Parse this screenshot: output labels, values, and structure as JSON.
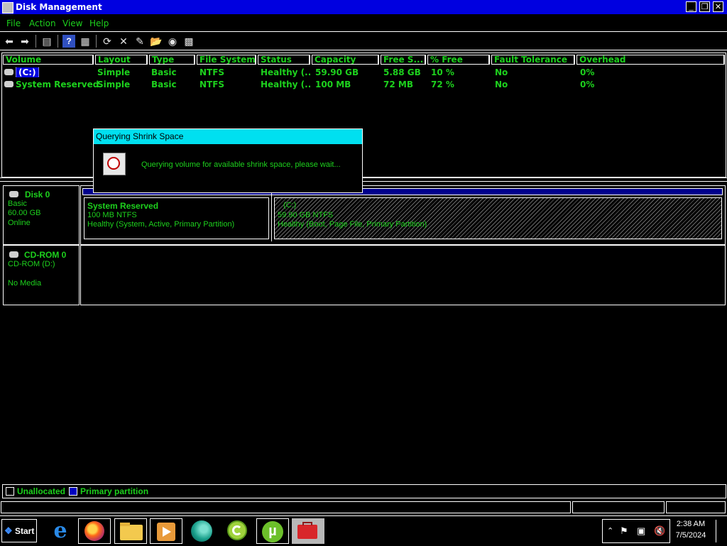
{
  "window": {
    "title": "Disk Management"
  },
  "menu": [
    "File",
    "Action",
    "View",
    "Help"
  ],
  "toolbar": {
    "buttons": [
      "back-icon",
      "forward-icon",
      "list-view-icon",
      "help-icon",
      "properties-icon",
      "refresh-icon",
      "delete-icon",
      "rename-icon",
      "open-icon",
      "explore-icon",
      "settings-icon"
    ]
  },
  "volume_list": {
    "columns": [
      "Volume",
      "Layout",
      "Type",
      "File System",
      "Status",
      "Capacity",
      "Free S...",
      "% Free",
      "Fault Tolerance",
      "Overhead"
    ],
    "rows": [
      {
        "volume": "(C:)",
        "layout": "Simple",
        "type": "Basic",
        "fs": "NTFS",
        "status": "Healthy (...",
        "capacity": "59.90 GB",
        "free": "5.88 GB",
        "pct_free": "10 %",
        "fault": "No",
        "overhead": "0%",
        "selected": true
      },
      {
        "volume": "System Reserved",
        "layout": "Simple",
        "type": "Basic",
        "fs": "NTFS",
        "status": "Healthy (...",
        "capacity": "100 MB",
        "free": "72 MB",
        "pct_free": "72 %",
        "fault": "No",
        "overhead": "0%",
        "selected": false
      }
    ]
  },
  "disks": [
    {
      "name": "Disk 0",
      "type": "Basic",
      "size": "60.00 GB",
      "state": "Online",
      "partitions": [
        {
          "name": "System Reserved",
          "size": "100 MB NTFS",
          "status": "Healthy (System, Active, Primary Partition)"
        },
        {
          "name": "(C:)",
          "size": "59.90 GB NTFS",
          "status": "Healthy (Boot, Page File, Primary Partition)"
        }
      ]
    },
    {
      "name": "CD-ROM 0",
      "type": "CD-ROM (D:)",
      "state": "No Media"
    }
  ],
  "dialog": {
    "title": "Querying Shrink Space",
    "message": "Querying volume for available shrink space, please wait..."
  },
  "legend": [
    {
      "label": "Unallocated",
      "color": "#000000"
    },
    {
      "label": "Primary partition",
      "color": "#0000c0"
    }
  ],
  "taskbar": {
    "start_label": "Start",
    "apps": [
      "internet-explorer-icon",
      "firefox-icon",
      "file-explorer-icon",
      "media-player-icon",
      "edge-icon",
      "ccleaner-icon",
      "utorrent-icon",
      "toolbox-icon"
    ],
    "clock": {
      "time": "2:38 AM",
      "date": "7/5/2024"
    }
  },
  "colors": {
    "text": "#1dd11d",
    "titlebar": "#0000e0",
    "dialog_title": "#00e0f0",
    "selection": "#0000e0"
  }
}
